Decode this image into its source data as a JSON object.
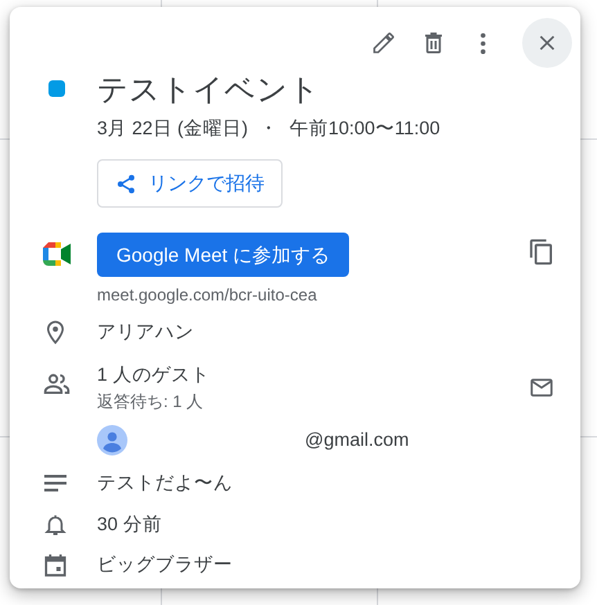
{
  "event": {
    "title": "テストイベント",
    "color": "#039be5",
    "date": "3月 22日 (金曜日)",
    "separator": "・",
    "time": "午前10:00〜11:00"
  },
  "invite_button": "リンクで招待",
  "meet": {
    "button": "Google Meet に参加する",
    "url": "meet.google.com/bcr-uito-cea"
  },
  "location": "アリアハン",
  "guests": {
    "count": "1 人のゲスト",
    "pending": "返答待ち: 1 人",
    "list": [
      {
        "email": "@gmail.com"
      }
    ]
  },
  "description": "テストだよ〜ん",
  "reminder": "30 分前",
  "calendar": "ビッグブラザー"
}
